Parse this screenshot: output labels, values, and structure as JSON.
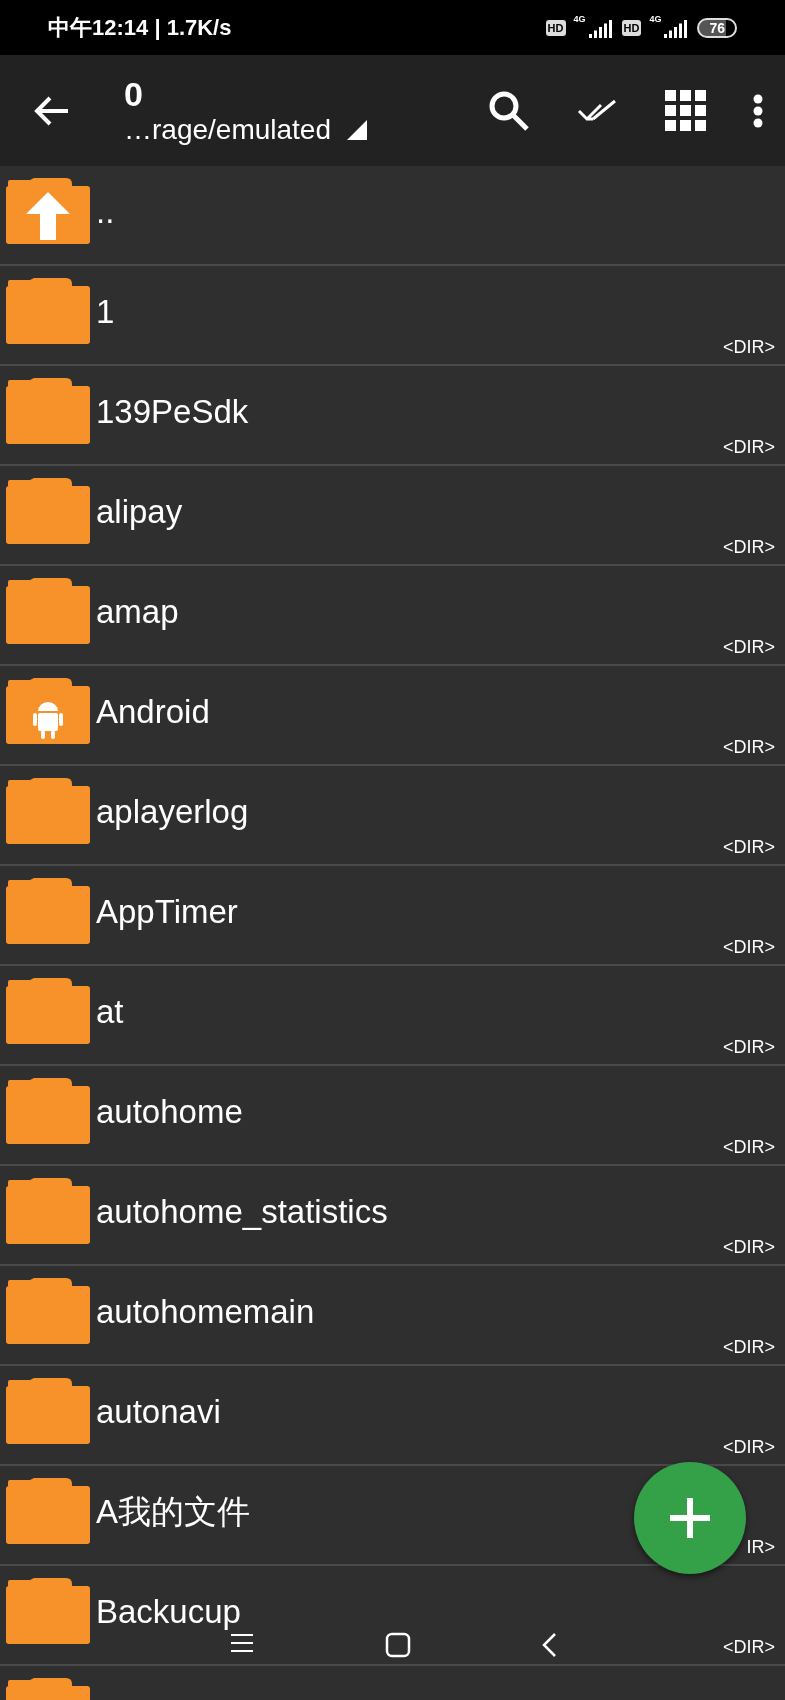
{
  "status_bar": {
    "time": "中午12:14 | 1.7K/s",
    "sims": [
      {
        "hd": "HD",
        "network": "4G"
      },
      {
        "hd": "HD",
        "network": "4G"
      }
    ],
    "battery": "76"
  },
  "toolbar": {
    "title": "0",
    "path": "…rage/emulated"
  },
  "files": [
    {
      "kind": "up",
      "name": ".."
    },
    {
      "kind": "folder",
      "name": "1",
      "type": "<DIR>"
    },
    {
      "kind": "folder",
      "name": "139PeSdk",
      "type": "<DIR>"
    },
    {
      "kind": "folder",
      "name": "alipay",
      "type": "<DIR>"
    },
    {
      "kind": "folder",
      "name": "amap",
      "type": "<DIR>"
    },
    {
      "kind": "android",
      "name": "Android",
      "type": "<DIR>"
    },
    {
      "kind": "folder",
      "name": "aplayerlog",
      "type": "<DIR>"
    },
    {
      "kind": "folder",
      "name": "AppTimer",
      "type": "<DIR>"
    },
    {
      "kind": "folder",
      "name": "at",
      "type": "<DIR>"
    },
    {
      "kind": "folder",
      "name": "autohome",
      "type": "<DIR>"
    },
    {
      "kind": "folder",
      "name": "autohome_statistics",
      "type": "<DIR>"
    },
    {
      "kind": "folder",
      "name": "autohomemain",
      "type": "<DIR>"
    },
    {
      "kind": "folder",
      "name": "autonavi",
      "type": "<DIR>"
    },
    {
      "kind": "folder",
      "name": "A我的文件",
      "type": "IR>"
    },
    {
      "kind": "folder",
      "name": "Backucup",
      "type": "<DIR>"
    },
    {
      "kind": "folder"
    }
  ]
}
